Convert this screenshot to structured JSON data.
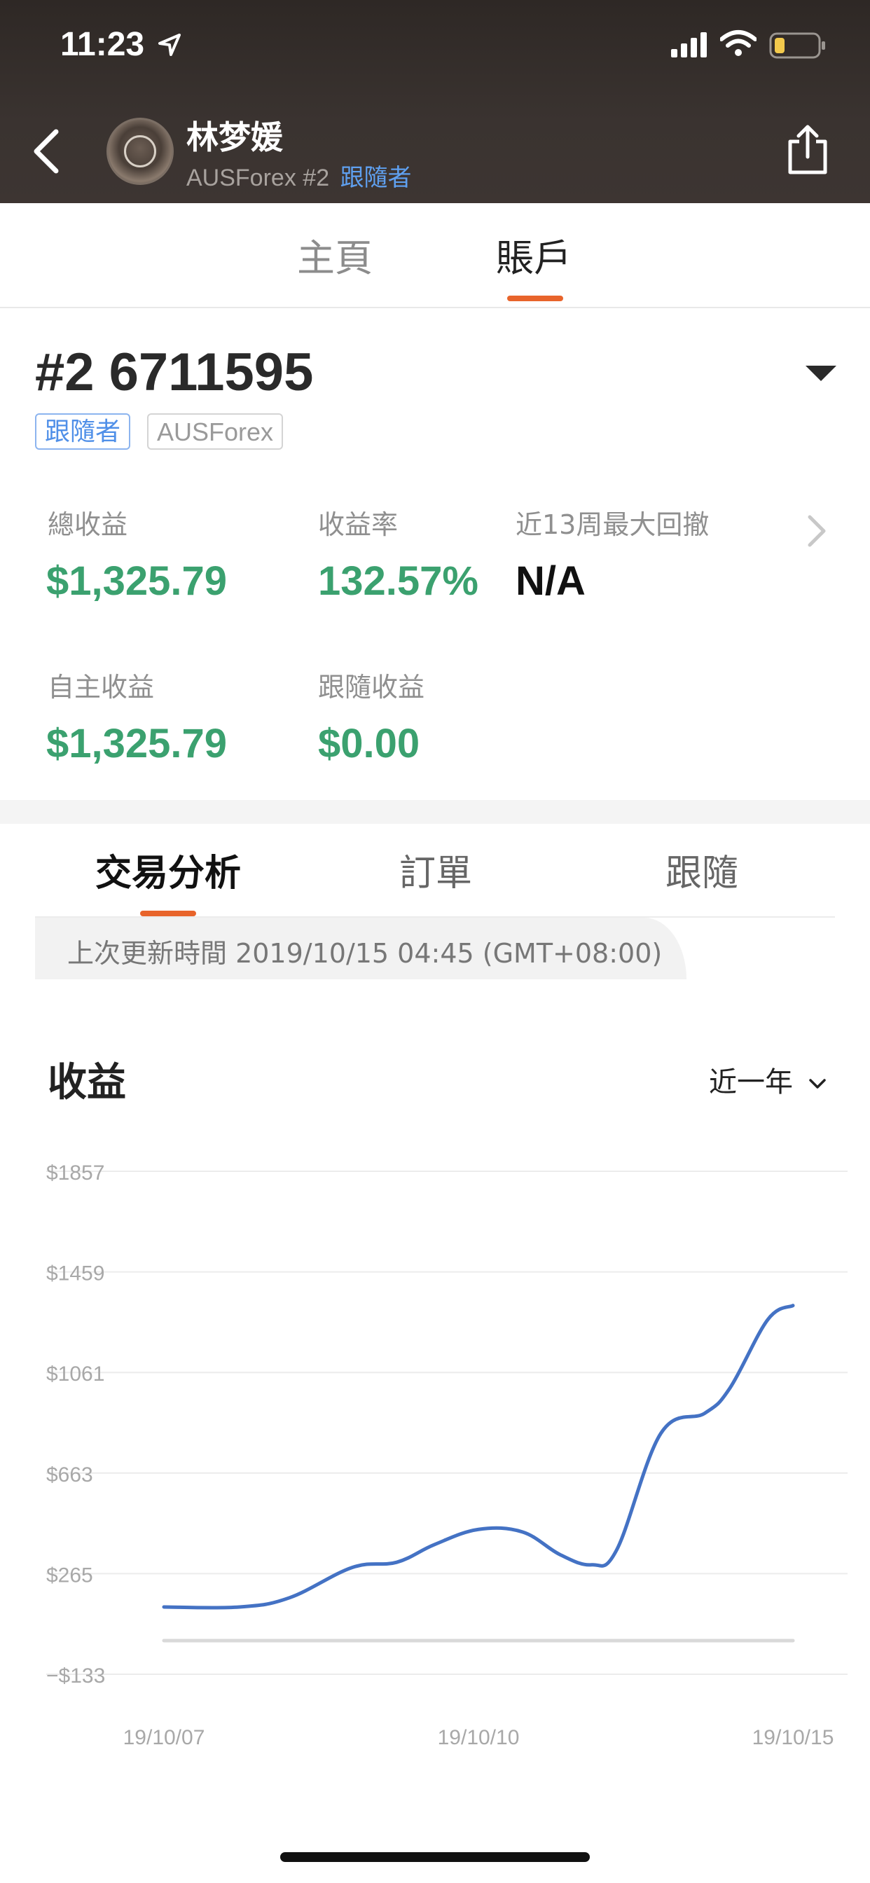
{
  "status_bar": {
    "time": "11:23"
  },
  "header": {
    "user_name": "林梦媛",
    "broker": "AUSForex",
    "account_index": "#2",
    "role": "跟隨者"
  },
  "top_tabs": [
    {
      "label": "主頁",
      "active": false
    },
    {
      "label": "賬戶",
      "active": true
    }
  ],
  "account": {
    "number": "#2 6711595",
    "tags": [
      "跟隨者",
      "AUSForex"
    ]
  },
  "stats": {
    "total_profit_label": "總收益",
    "total_profit_value": "$1,325.79",
    "return_rate_label": "收益率",
    "return_rate_value": "132.57%",
    "max_drawdown_label": "近13周最大回撤",
    "max_drawdown_value": "N/A",
    "self_profit_label": "自主收益",
    "self_profit_value": "$1,325.79",
    "follow_profit_label": "跟隨收益",
    "follow_profit_value": "$0.00"
  },
  "sub_tabs": [
    {
      "label": "交易分析",
      "active": true
    },
    {
      "label": "訂單",
      "active": false
    },
    {
      "label": "跟隨",
      "active": false
    }
  ],
  "update_info": "上次更新時間 2019/10/15 04:45 (GMT+08:00)",
  "chart_section": {
    "title": "收益",
    "period": "近一年"
  },
  "colors": {
    "accent": "#e8642b",
    "profit_green": "#3ba16f",
    "line_blue": "#4472c4",
    "link_blue": "#5fa0f0"
  },
  "chart_data": {
    "type": "line",
    "title": "收益",
    "xlabel": "",
    "ylabel": "",
    "yticks": [
      -133,
      265,
      663,
      1061,
      1459,
      1857
    ],
    "ytick_labels": [
      "−$133",
      "$265",
      "$663",
      "$1061",
      "$1459",
      "$1857"
    ],
    "ylim": [
      -133,
      1857
    ],
    "xtick_labels": [
      "19/10/07",
      "19/10/10",
      "19/10/15"
    ],
    "grid": true,
    "series": [
      {
        "values": [
          {
            "x": 0.0,
            "y": 133
          },
          {
            "x": 0.12,
            "y": 133
          },
          {
            "x": 0.2,
            "y": 170
          },
          {
            "x": 0.3,
            "y": 290
          },
          {
            "x": 0.37,
            "y": 310
          },
          {
            "x": 0.43,
            "y": 380
          },
          {
            "x": 0.5,
            "y": 440
          },
          {
            "x": 0.57,
            "y": 430
          },
          {
            "x": 0.63,
            "y": 340
          },
          {
            "x": 0.68,
            "y": 300
          },
          {
            "x": 0.72,
            "y": 360
          },
          {
            "x": 0.79,
            "y": 820
          },
          {
            "x": 0.86,
            "y": 900
          },
          {
            "x": 0.9,
            "y": 1000
          },
          {
            "x": 0.96,
            "y": 1270
          },
          {
            "x": 1.0,
            "y": 1325.79
          }
        ]
      },
      {
        "values": [
          {
            "x": 0.0,
            "y": 0
          },
          {
            "x": 1.0,
            "y": 0
          }
        ]
      }
    ]
  }
}
